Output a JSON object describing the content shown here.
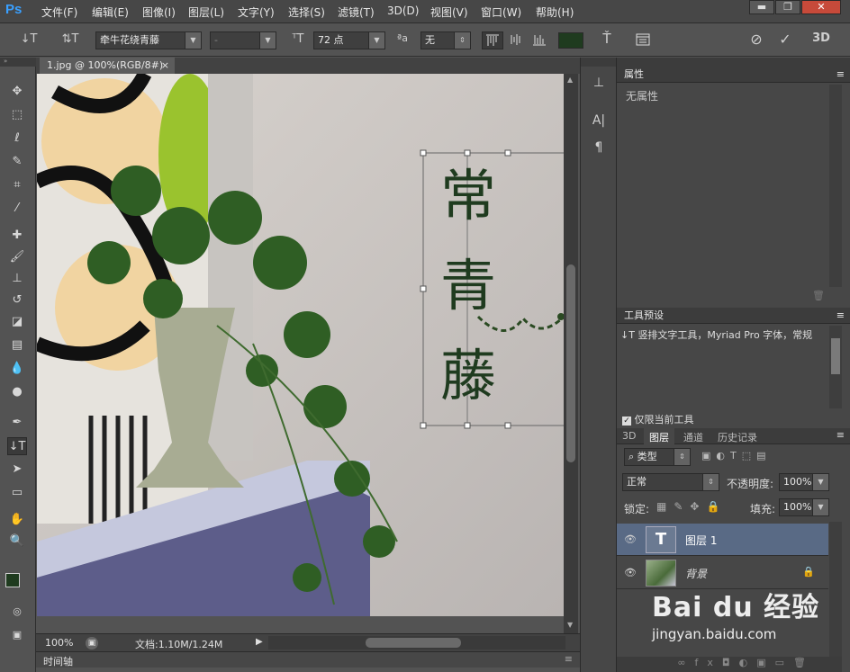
{
  "app": {
    "logo": "Ps",
    "accent": "#3aa0ff"
  },
  "menu": [
    "文件(F)",
    "编辑(E)",
    "图像(I)",
    "图层(L)",
    "文字(Y)",
    "选择(S)",
    "滤镜(T)",
    "3D(D)",
    "视图(V)",
    "窗口(W)",
    "帮助(H)"
  ],
  "window_buttons": {
    "minimize": "▬",
    "restore": "❐",
    "close": "✕"
  },
  "options": {
    "tool_icon": "↓T",
    "orient_icon": "⇅T",
    "font_family": "牵牛花绕青藤",
    "font_style": "-",
    "font_size_icon": "ᵀT",
    "font_size": "72 点",
    "aa_icon": "ªa",
    "antialias": "无",
    "color": "#1f3b1f",
    "cancel_icon": "⊘",
    "commit_icon": "✓",
    "three_d": "3D"
  },
  "doc": {
    "tab_title": "1.jpg @ 100%(RGB/8#)",
    "tab_close": "×"
  },
  "canvas_text": [
    "常",
    "青",
    "藤"
  ],
  "status": {
    "zoom": "100%",
    "doc_info": "文档:1.10M/1.24M"
  },
  "timeline": {
    "label": "时间轴"
  },
  "panels": {
    "properties": {
      "title": "属性",
      "body": "无属性"
    },
    "tool_presets": {
      "title": "工具预设",
      "item": "竖排文字工具，Myriad Pro 字体，常规",
      "item_icon": "↓T",
      "only_current": "仅限当前工具"
    },
    "layers": {
      "tabs": [
        "3D",
        "图层",
        "通道",
        "历史记录"
      ],
      "active_tab": "图层",
      "filter_kind": "类型",
      "blend_mode": "正常",
      "opacity_label": "不透明度:",
      "opacity": "100%",
      "lock_label": "锁定:",
      "fill_label": "填充:",
      "fill": "100%",
      "items": [
        {
          "name": "图层 1",
          "thumb": "T",
          "locked": false,
          "selected": true
        },
        {
          "name": "背景",
          "thumb": "",
          "locked": true,
          "selected": false
        }
      ]
    }
  },
  "watermark": {
    "brand": "Bai du 经验",
    "url": "jingyan.baidu.com"
  }
}
